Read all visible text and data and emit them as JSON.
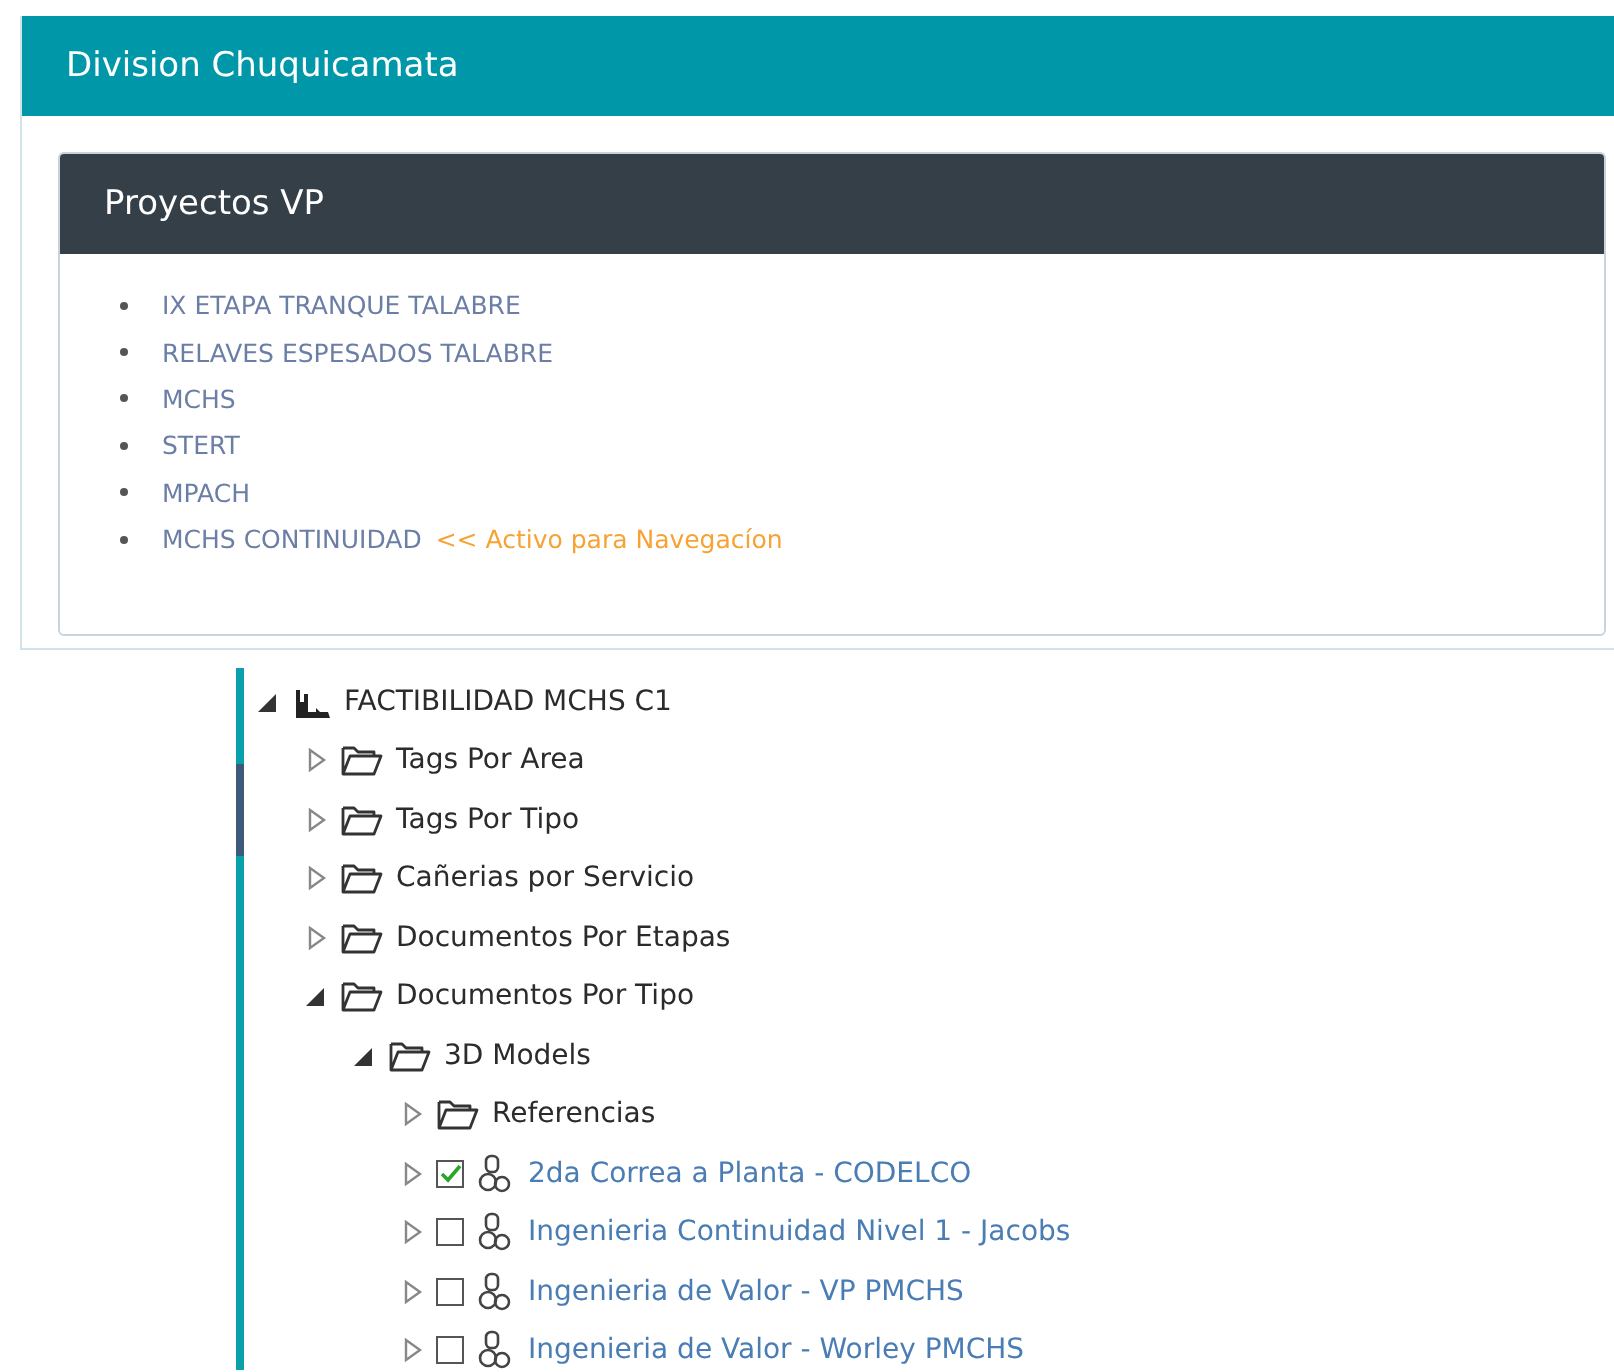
{
  "panel": {
    "title": "Division Chuquicamata"
  },
  "card": {
    "title": "Proyectos VP",
    "projects": [
      {
        "name": "IX ETAPA TRANQUE TALABRE"
      },
      {
        "name": "RELAVES ESPESADOS TALABRE"
      },
      {
        "name": "MCHS"
      },
      {
        "name": "STERT"
      },
      {
        "name": "MPACH"
      },
      {
        "name": "MCHS CONTINUIDAD",
        "note": "<< Activo para Navegacíon"
      }
    ]
  },
  "tree": [
    {
      "kind": "plant",
      "label": "FACTIBILIDAD MCHS C1",
      "expanded": true,
      "children": [
        {
          "kind": "folder",
          "label": "Tags Por Area",
          "expanded": false
        },
        {
          "kind": "folder",
          "label": "Tags Por Tipo",
          "expanded": false
        },
        {
          "kind": "folder",
          "label": "Cañerias por Servicio",
          "expanded": false
        },
        {
          "kind": "folder",
          "label": "Documentos Por Etapas",
          "expanded": false
        },
        {
          "kind": "folder",
          "label": "Documentos Por Tipo",
          "expanded": true,
          "children": [
            {
              "kind": "folder",
              "label": "3D Models",
              "expanded": true,
              "children": [
                {
                  "kind": "folder",
                  "label": "Referencias",
                  "expanded": false
                },
                {
                  "kind": "model",
                  "label": "2da Correa a Planta - CODELCO",
                  "expanded": false,
                  "checked": true
                },
                {
                  "kind": "model",
                  "label": "Ingenieria Continuidad Nivel 1 - Jacobs",
                  "expanded": false,
                  "checked": false
                },
                {
                  "kind": "model",
                  "label": "Ingenieria de Valor - VP PMCHS",
                  "expanded": false,
                  "checked": false
                },
                {
                  "kind": "model",
                  "label": "Ingenieria de Valor - Worley PMCHS",
                  "expanded": false,
                  "checked": false
                }
              ]
            }
          ]
        }
      ]
    }
  ]
}
